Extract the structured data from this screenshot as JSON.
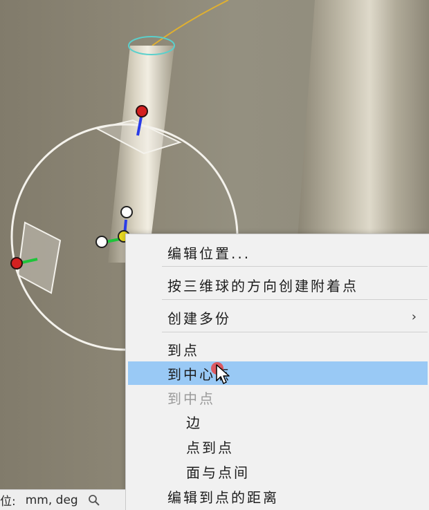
{
  "viewport": {
    "background_color": "#8c8676",
    "rod_color": "#d8d2c0",
    "rotation_sphere_color": "#f4f2ec",
    "handle_red": "#d42020",
    "axis_blue": "#2a3ce8",
    "axis_green": "#1ec43a",
    "handle_yellow": "#e8d820",
    "selection_ring_color": "#5ad0cc",
    "curve_color": "#e0b030"
  },
  "context_menu": {
    "highlight_color": "#99c9f5",
    "items": [
      {
        "label": "编辑位置..."
      },
      {
        "label": "按三维球的方向创建附着点"
      },
      {
        "label": "创建多份",
        "submenu_arrow": "›"
      },
      {
        "label": "到点"
      },
      {
        "label": "到中心点",
        "state": "highlighted"
      },
      {
        "label": "到中点",
        "state": "disabled"
      },
      {
        "label": "边"
      },
      {
        "label": "点到点"
      },
      {
        "label": "面与点间"
      },
      {
        "label": "编辑到点的距离"
      }
    ]
  },
  "status_bar": {
    "units_label": "位:",
    "units_value": "mm, deg",
    "icon": "magnifier-icon"
  }
}
